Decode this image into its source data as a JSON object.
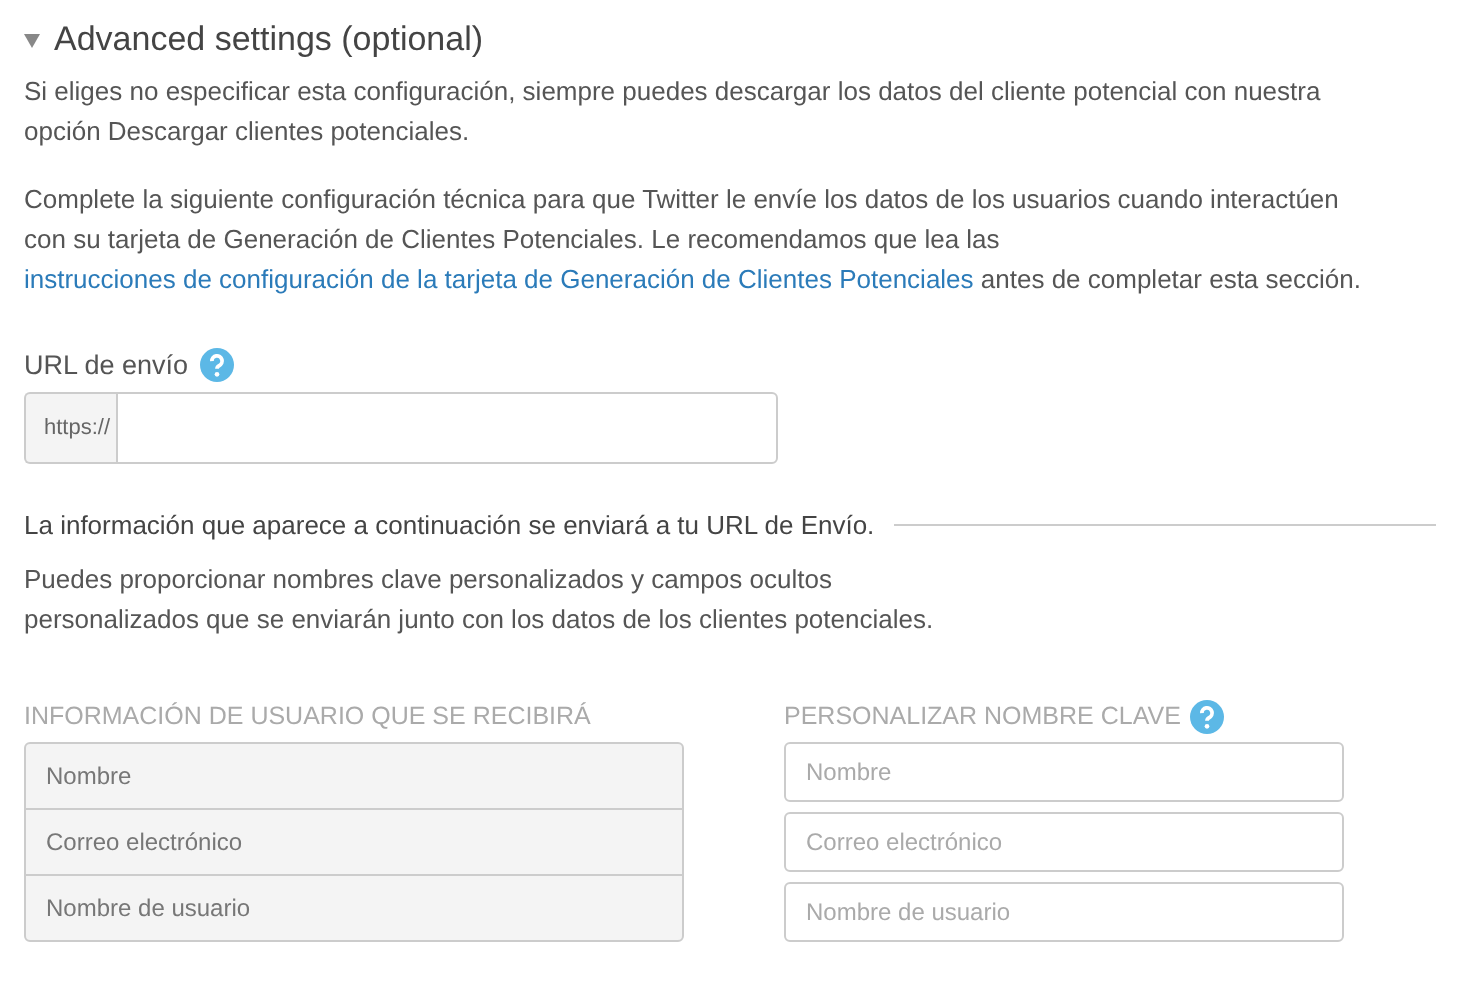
{
  "section": {
    "title": "Advanced settings (optional)",
    "expanded": true
  },
  "intro": "Si eliges no especificar esta configuración, siempre puedes descargar los datos del cliente potencial con nuestra opción Descargar clientes potenciales.",
  "instructions": {
    "text_before": "Complete la siguiente configuración técnica para que Twitter le envíe los datos de los usuarios cuando interactúen con su tarjeta de Generación de Clientes Potenciales. Le recomendamos que lea las",
    "link": "instrucciones de configuración de la tarjeta de Generación de Clientes Potenciales",
    "text_after": "antes de completar esta sección."
  },
  "url_field": {
    "label": "URL de envío",
    "prefix": "https://"
  },
  "divider_text": "La información que aparece a continuación se enviará a tu URL de Envío.",
  "custom_note": "Puedes proporcionar nombres clave personalizados y campos ocultos personalizados que se enviarán junto con los datos de los clientes potenciales.",
  "user_info": {
    "heading": "INFORMACIÓN DE USUARIO QUE SE RECIBIRÁ",
    "rows": [
      "Nombre",
      "Correo electrónico",
      "Nombre de usuario"
    ]
  },
  "custom_keys": {
    "heading": "PERSONALIZAR NOMBRE CLAVE",
    "fields": [
      {
        "placeholder": "Nombre"
      },
      {
        "placeholder": "Correo electrónico"
      },
      {
        "placeholder": "Nombre de usuario"
      }
    ]
  }
}
